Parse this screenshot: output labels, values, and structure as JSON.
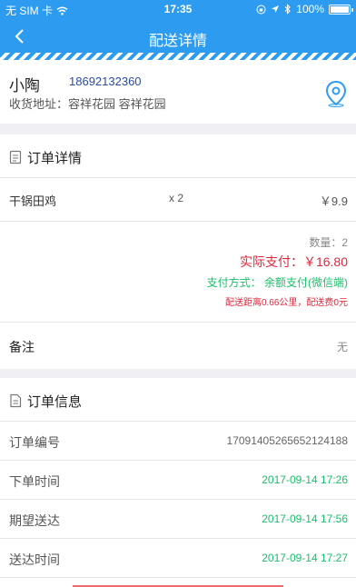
{
  "status_bar": {
    "carrier": "无 SIM 卡",
    "time": "17:35",
    "battery": "100%"
  },
  "nav": {
    "title": "配送详情"
  },
  "contact": {
    "name": "小陶",
    "phone": "18692132360",
    "address": "收货地址：容祥花园 容祥花园"
  },
  "order_details": {
    "title": "订单详情",
    "items": [
      {
        "name": "干锅田鸡",
        "qty": "x 2",
        "price": "￥9.9"
      }
    ],
    "count_label": "数量：2",
    "actual_pay": "实际支付：￥16.80",
    "pay_method": "支付方式：  余额支付(微信端)",
    "delivery_note": "配送距离0.66公里，配送费0元"
  },
  "note": {
    "label": "备注",
    "value": "无"
  },
  "order_info": {
    "title": "订单信息",
    "rows": [
      {
        "label": "订单编号",
        "value": "17091405265652124188"
      },
      {
        "label": "下单时间",
        "value": "2017-09-14 17:26"
      },
      {
        "label": "期望送达",
        "value": "2017-09-14 17:56"
      },
      {
        "label": "送达时间",
        "value": "2017-09-14 17:27"
      }
    ]
  },
  "colors": {
    "primary": "#2d9cf0",
    "price_red": "#e0283c",
    "green": "#1bbf6b"
  },
  "icons": {
    "back": "chevron-left-icon",
    "location": "location-pin-icon",
    "document": "document-icon"
  }
}
